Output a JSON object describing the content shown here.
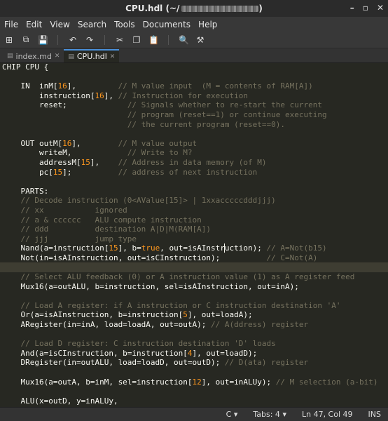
{
  "window": {
    "title_prefix": "CPU.hdl (~/",
    "title_suffix": ")",
    "controls": {
      "minimize": "–",
      "maximize": "▫",
      "close": "✕"
    }
  },
  "menu": [
    "File",
    "Edit",
    "View",
    "Search",
    "Tools",
    "Documents",
    "Help"
  ],
  "toolbar": {
    "icons": [
      "new-document-icon",
      "open-document-icon",
      "save-icon",
      "undo-icon",
      "redo-icon",
      "cut-icon",
      "copy-icon",
      "paste-icon",
      "search-icon",
      "replace-icon"
    ],
    "glyphs": [
      "⊞",
      "⧉",
      "💾",
      "↶",
      "↷",
      "✂",
      "❐",
      "📋",
      "🔍",
      "⚒"
    ]
  },
  "tabs": [
    {
      "label": "index.md",
      "icon": "document-icon",
      "close": "✕",
      "active": false
    },
    {
      "label": "CPU.hdl",
      "icon": "document-icon",
      "close": "✕",
      "active": true
    }
  ],
  "code": {
    "current_line": 21,
    "lines": [
      [
        [
          "t",
          "CHIP CPU {"
        ]
      ],
      [
        [
          "t",
          ""
        ]
      ],
      [
        [
          "t",
          "    IN  inM["
        ],
        [
          "n",
          "16"
        ],
        [
          "t",
          "],         "
        ],
        [
          "c",
          "// M value input  (M = contents of RAM[A])"
        ]
      ],
      [
        [
          "t",
          "        instruction["
        ],
        [
          "n",
          "16"
        ],
        [
          "t",
          "], "
        ],
        [
          "c",
          "// Instruction for execution"
        ]
      ],
      [
        [
          "t",
          "        reset;             "
        ],
        [
          "c",
          "// Signals whether to re-start the current"
        ]
      ],
      [
        [
          "t",
          "                           "
        ],
        [
          "c",
          "// program (reset==1) or continue executing"
        ]
      ],
      [
        [
          "t",
          "                           "
        ],
        [
          "c",
          "// the current program (reset==0)."
        ]
      ],
      [
        [
          "t",
          ""
        ]
      ],
      [
        [
          "t",
          "    OUT outM["
        ],
        [
          "n",
          "16"
        ],
        [
          "t",
          "],        "
        ],
        [
          "c",
          "// M value output"
        ]
      ],
      [
        [
          "t",
          "        writeM,            "
        ],
        [
          "c",
          "// Write to M?"
        ]
      ],
      [
        [
          "t",
          "        addressM["
        ],
        [
          "n",
          "15"
        ],
        [
          "t",
          "],    "
        ],
        [
          "c",
          "// Address in data memory (of M)"
        ]
      ],
      [
        [
          "t",
          "        pc["
        ],
        [
          "n",
          "15"
        ],
        [
          "t",
          "];          "
        ],
        [
          "c",
          "// address of next instruction"
        ]
      ],
      [
        [
          "t",
          ""
        ]
      ],
      [
        [
          "t",
          "    PARTS:"
        ]
      ],
      [
        [
          "c",
          "    // Decode instruction (0<AValue[15]> | 1xxacccccdddjjj)"
        ]
      ],
      [
        [
          "c",
          "    // xx           ignored"
        ]
      ],
      [
        [
          "c",
          "    // a & cccccc   ALU compute instruction"
        ]
      ],
      [
        [
          "c",
          "    // ddd          destination A|D|M(RAM[A])"
        ]
      ],
      [
        [
          "c",
          "    // jjj          jump type"
        ]
      ],
      [
        [
          "t",
          "    Nand(a=instruction["
        ],
        [
          "n",
          "15"
        ],
        [
          "t",
          "], b="
        ],
        [
          "k",
          "true"
        ],
        [
          "t",
          ", out=isAInstr"
        ],
        [
          "cur",
          ""
        ],
        [
          "t",
          "uction); "
        ],
        [
          "c",
          "// A=Not(b15)"
        ]
      ],
      [
        [
          "t",
          "    Not(in=isAInstruction, out=isCInstruction);          "
        ],
        [
          "c",
          "// C=Not(A)"
        ]
      ],
      [
        [
          "t",
          ""
        ]
      ],
      [
        [
          "c",
          "    // Select ALU feedback (0) or A instruction value (1) as A register feed"
        ]
      ],
      [
        [
          "t",
          "    Mux16(a=outALU, b=instruction, sel=isAInstruction, out=inA);"
        ]
      ],
      [
        [
          "t",
          ""
        ]
      ],
      [
        [
          "c",
          "    // Load A register: if A instruction or C instruction destination 'A'"
        ]
      ],
      [
        [
          "t",
          "    Or(a=isAInstruction, b=instruction["
        ],
        [
          "n",
          "5"
        ],
        [
          "t",
          "], out=loadA);"
        ]
      ],
      [
        [
          "t",
          "    ARegister(in=inA, load=loadA, out=outA); "
        ],
        [
          "c",
          "// A(ddress) register"
        ]
      ],
      [
        [
          "t",
          ""
        ]
      ],
      [
        [
          "c",
          "    // Load D register: C instruction destination 'D' loads"
        ]
      ],
      [
        [
          "t",
          "    And(a=isCInstruction, b=instruction["
        ],
        [
          "n",
          "4"
        ],
        [
          "t",
          "], out=loadD);"
        ]
      ],
      [
        [
          "t",
          "    DRegister(in=outALU, load=loadD, out=outD); "
        ],
        [
          "c",
          "// D(ata) register"
        ]
      ],
      [
        [
          "t",
          ""
        ]
      ],
      [
        [
          "t",
          "    Mux16(a=outA, b=inM, sel=instruction["
        ],
        [
          "n",
          "12"
        ],
        [
          "t",
          "], out=inALUy); "
        ],
        [
          "c",
          "// M selection (a-bit)"
        ]
      ],
      [
        [
          "t",
          ""
        ]
      ],
      [
        [
          "t",
          "    ALU(x=outD, y=inALUy,"
        ]
      ]
    ]
  },
  "status": {
    "language": "C",
    "language_arrow": "▾",
    "tabs": "Tabs: 4",
    "tabs_arrow": "▾",
    "position": "Ln 47, Col 49",
    "mode": "INS"
  },
  "colors": {
    "background": "#272822",
    "comment": "#75715e",
    "number": "#fd971f",
    "text": "#f8f8f2",
    "current_line": "#3e3d32"
  }
}
